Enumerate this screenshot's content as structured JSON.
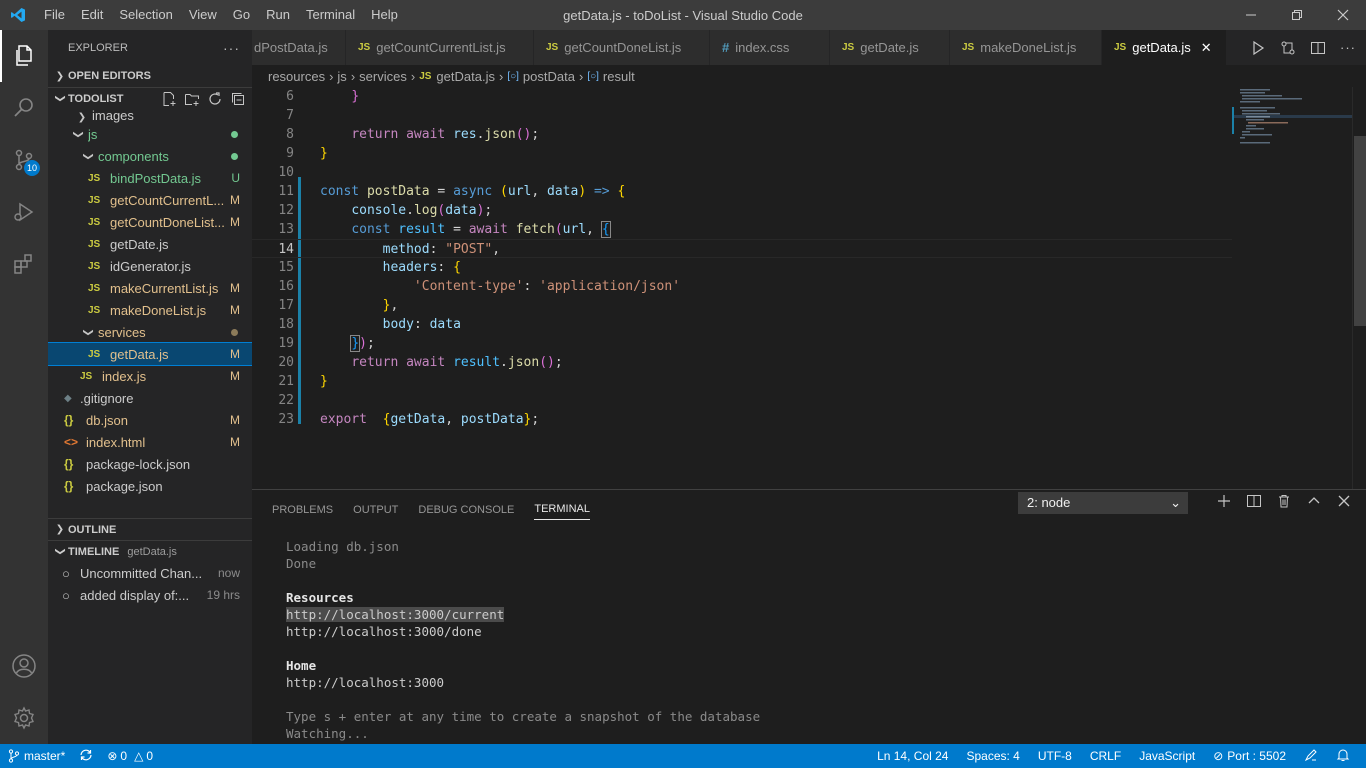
{
  "window": {
    "title": "getData.js - toDoList - Visual Studio Code",
    "menu": [
      "File",
      "Edit",
      "Selection",
      "View",
      "Go",
      "Run",
      "Terminal",
      "Help"
    ]
  },
  "activity_bar": {
    "source_control_badge": "10"
  },
  "sidebar": {
    "header": "EXPLORER",
    "header_more": "···",
    "open_editors": "OPEN EDITORS",
    "project": "TODOLIST",
    "tree": {
      "images": "images",
      "js": "js",
      "components": "components",
      "bindPostData": "bindPostData.js",
      "bindPostData_status": "U",
      "getCountCurrent": "getCountCurrentL...",
      "getCountCurrent_status": "M",
      "getCountDone": "getCountDoneList...",
      "getCountDone_status": "M",
      "getDate": "getDate.js",
      "idGenerator": "idGenerator.js",
      "makeCurrentList": "makeCurrentList.js",
      "makeCurrentList_status": "M",
      "makeDoneList": "makeDoneList.js",
      "makeDoneList_status": "M",
      "services": "services",
      "getData": "getData.js",
      "getData_status": "M",
      "index": "index.js",
      "index_status": "M",
      "gitignore": ".gitignore",
      "db": "db.json",
      "db_status": "M",
      "indexhtml": "index.html",
      "indexhtml_status": "M",
      "packagelock": "package-lock.json",
      "package": "package.json"
    },
    "outline": "OUTLINE",
    "timeline": "TIMELINE",
    "timeline_file": "getData.js",
    "timeline_items": [
      {
        "label": "Uncommitted Chan...",
        "time": "now"
      },
      {
        "label": "added display of:...",
        "time": "19 hrs"
      }
    ]
  },
  "tabs": [
    {
      "label": "dPostData.js",
      "icon": "JS"
    },
    {
      "label": "getCountCurrentList.js",
      "icon": "JS"
    },
    {
      "label": "getCountDoneList.js",
      "icon": "JS"
    },
    {
      "label": "index.css",
      "icon": "#"
    },
    {
      "label": "getDate.js",
      "icon": "JS"
    },
    {
      "label": "makeDoneList.js",
      "icon": "JS"
    },
    {
      "label": "getData.js",
      "icon": "JS"
    }
  ],
  "breadcrumb": [
    "resources",
    "js",
    "services",
    "getData.js",
    "postData",
    "result"
  ],
  "editor": {
    "line_numbers": [
      "6",
      "7",
      "8",
      "9",
      "10",
      "11",
      "12",
      "13",
      "14",
      "15",
      "16",
      "17",
      "18",
      "19",
      "20",
      "21",
      "22",
      "23"
    ]
  },
  "panel": {
    "tabs": [
      "PROBLEMS",
      "OUTPUT",
      "DEBUG CONSOLE",
      "TERMINAL"
    ],
    "terminal_select": "2: node",
    "terminal_lines": {
      "l1": "Loading db.json",
      "l2": "Done",
      "l3": "Resources",
      "l4": "http://localhost:3000/current",
      "l5": "http://localhost:3000/done",
      "l6": "Home",
      "l7": "http://localhost:3000",
      "l8": "Type s + enter at any time to create a snapshot of the database",
      "l9": "Watching..."
    }
  },
  "statusbar": {
    "branch": "master*",
    "errors": "0",
    "warnings": "0",
    "position": "Ln 14, Col 24",
    "spaces": "Spaces: 4",
    "encoding": "UTF-8",
    "eol": "CRLF",
    "language": "JavaScript",
    "port": "Port : 5502"
  },
  "colors": {
    "accent": "#007acc",
    "modified": "#e2c08d",
    "untracked": "#73c991"
  }
}
